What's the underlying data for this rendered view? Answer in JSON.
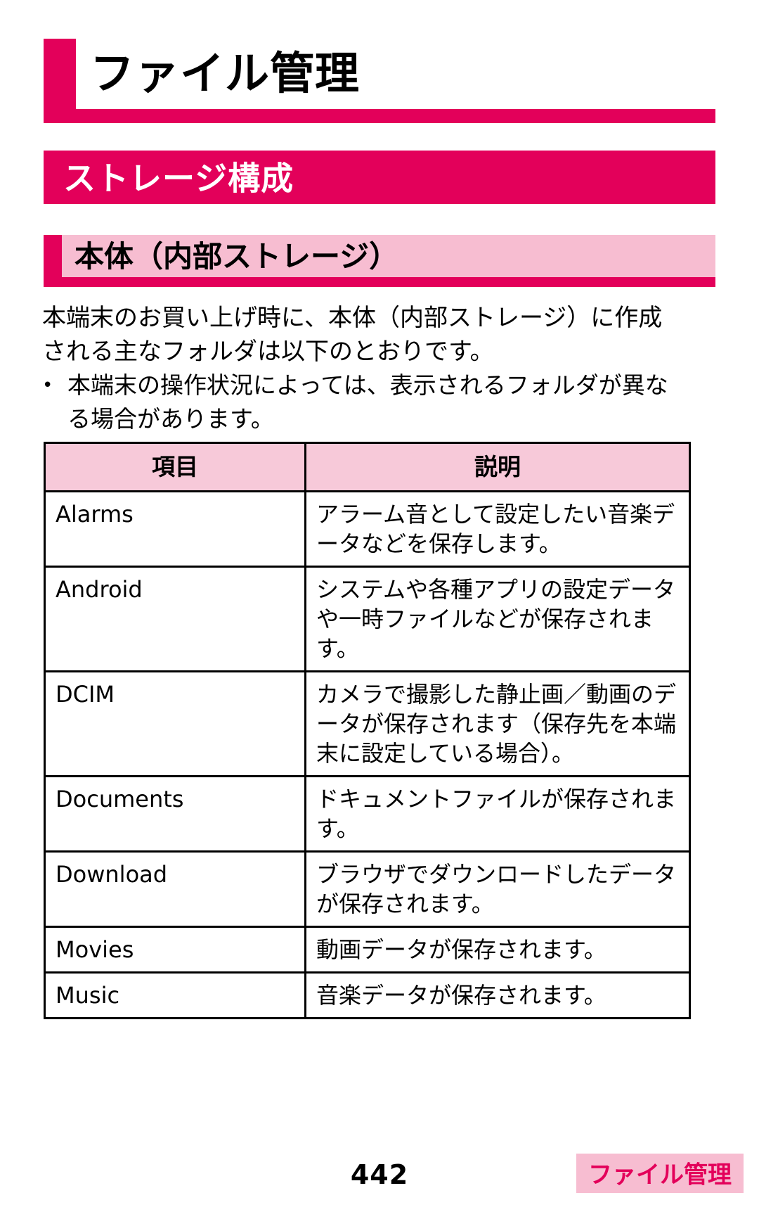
{
  "chapter": {
    "title": "ファイル管理"
  },
  "headings": {
    "section": "ストレージ構成",
    "subsection": "本体（内部ストレージ）"
  },
  "body": {
    "paragraph": "本端末のお買い上げ時に、本体（内部ストレージ）に作成される主なフォルダは以下のとおりです。",
    "notes": [
      {
        "bullet": "•",
        "text": "本端末の操作状況によっては、表示されるフォルダが異なる場合があります。"
      }
    ]
  },
  "table": {
    "headers": [
      "項目",
      "説明"
    ],
    "rows": [
      {
        "item": "Alarms",
        "description": "アラーム音として設定したい音楽データなどを保存します。"
      },
      {
        "item": "Android",
        "description": "システムや各種アプリの設定データや一時ファイルなどが保存されます。"
      },
      {
        "item": "DCIM",
        "description": "カメラで撮影した静止画／動画のデータが保存されます（保存先を本端末に設定している場合）。"
      },
      {
        "item": "Documents",
        "description": "ドキュメントファイルが保存されます。"
      },
      {
        "item": "Download",
        "description": "ブラウザでダウンロードしたデータが保存されます。"
      },
      {
        "item": "Movies",
        "description": "動画データが保存されます。"
      },
      {
        "item": "Music",
        "description": "音楽データが保存されます。"
      }
    ]
  },
  "footer": {
    "page_number": "442",
    "tab_label": "ファイル管理"
  },
  "colors": {
    "accent": "#e3005a",
    "accent_light": "#f7bdd1",
    "table_header": "#f7c9d9"
  }
}
